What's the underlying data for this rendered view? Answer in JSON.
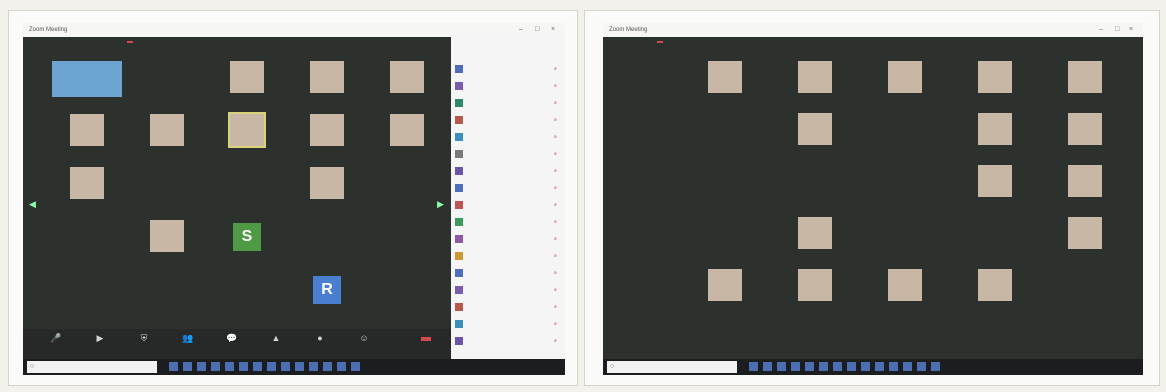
{
  "left": {
    "title": "Zoom Meeting",
    "topbar": {
      "left_items": [
        "",
        ""
      ],
      "rec": "",
      "right": ""
    },
    "tiles": [
      {
        "kind": "video",
        "label": ""
      },
      {
        "kind": "name",
        "big": "",
        "label": ""
      },
      {
        "kind": "video",
        "label": ""
      },
      {
        "kind": "video",
        "label": ""
      },
      {
        "kind": "video",
        "label": ""
      },
      {
        "kind": "video",
        "label": ""
      },
      {
        "kind": "video",
        "label": ""
      },
      {
        "kind": "video",
        "label": "",
        "selected": true
      },
      {
        "kind": "video",
        "label": ""
      },
      {
        "kind": "video",
        "label": ""
      },
      {
        "kind": "video",
        "label": ""
      },
      {
        "kind": "name",
        "big": "",
        "label": ""
      },
      {
        "kind": "name",
        "big": "",
        "label": ""
      },
      {
        "kind": "video",
        "label": ""
      },
      {
        "kind": "name",
        "big": "",
        "label": ""
      },
      {
        "kind": "name",
        "big": "",
        "label": ""
      },
      {
        "kind": "video",
        "label": ""
      },
      {
        "kind": "initial",
        "initial": "S",
        "color": "#4f9a45",
        "label": ""
      },
      {
        "kind": "name",
        "big": "",
        "label": ""
      },
      {
        "kind": "name",
        "big": "",
        "label": ""
      },
      {
        "kind": "name",
        "big": "",
        "label": ""
      },
      {
        "kind": "name",
        "big": "",
        "label": ""
      },
      {
        "kind": "name",
        "big": "",
        "label": ""
      },
      {
        "kind": "initial",
        "initial": "R",
        "color": "#4a7fd0",
        "label": ""
      }
    ],
    "toolbar": [
      "",
      "",
      "",
      "",
      "",
      "",
      "",
      ""
    ],
    "end": "",
    "panel": {
      "title": "",
      "subtitle": "",
      "participants": [
        "",
        "",
        "",
        "",
        "",
        "",
        "",
        "",
        "",
        "",
        "",
        "",
        "",
        "",
        "",
        "",
        ""
      ],
      "footer": [
        "",
        ""
      ]
    },
    "search": ""
  },
  "right": {
    "title": "Zoom Meeting",
    "topbar": {
      "left_items": [
        ""
      ],
      "rec": "",
      "right": ""
    },
    "tiles": [
      {
        "kind": "video",
        "label": ""
      },
      {
        "kind": "video",
        "label": ""
      },
      {
        "kind": "video",
        "label": ""
      },
      {
        "kind": "video",
        "label": ""
      },
      {
        "kind": "video",
        "label": ""
      },
      {
        "kind": "name",
        "big": "",
        "label": ""
      },
      {
        "kind": "video",
        "label": ""
      },
      {
        "kind": "name",
        "big": "",
        "label": ""
      },
      {
        "kind": "video",
        "label": ""
      },
      {
        "kind": "video",
        "label": ""
      },
      {
        "kind": "name",
        "big": "",
        "label": ""
      },
      {
        "kind": "name",
        "big": "",
        "label": ""
      },
      {
        "kind": "name",
        "big": "",
        "label": ""
      },
      {
        "kind": "video",
        "label": ""
      },
      {
        "kind": "video",
        "label": ""
      },
      {
        "kind": "name",
        "big": "",
        "label": ""
      },
      {
        "kind": "video",
        "label": ""
      },
      {
        "kind": "name",
        "big": "",
        "label": ""
      },
      {
        "kind": "name",
        "big": "",
        "label": ""
      },
      {
        "kind": "video",
        "label": ""
      },
      {
        "kind": "video",
        "label": ""
      },
      {
        "kind": "video",
        "label": ""
      },
      {
        "kind": "video",
        "label": ""
      },
      {
        "kind": "video",
        "label": ""
      }
    ],
    "search": ""
  },
  "icons": {
    "search": "search-icon",
    "minimize": "minimize-icon",
    "maximize": "maximize-icon",
    "close": "close-icon"
  }
}
